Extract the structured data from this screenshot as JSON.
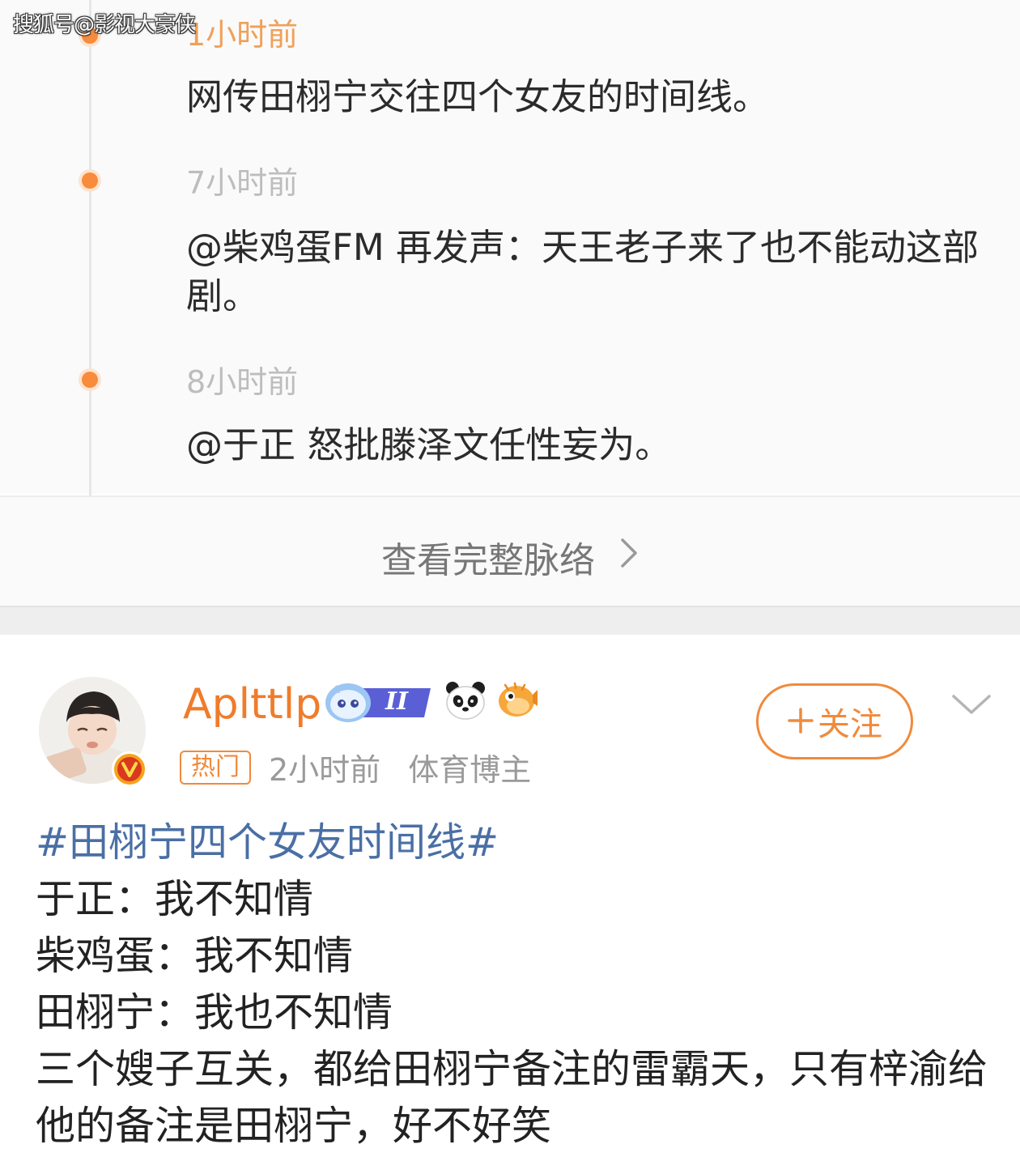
{
  "watermark": "搜狐号@影视大豪侠",
  "timeline": {
    "items": [
      {
        "time": "1小时前",
        "text": "网传田栩宁交往四个女友的时间线。"
      },
      {
        "time": "7小时前",
        "text": "@柴鸡蛋FM 再发声：天王老子来了也不能动这部剧。"
      },
      {
        "time": "8小时前",
        "text": "@于正 怒批滕泽文任性妄为。"
      }
    ],
    "view_full_label": "查看完整脉络"
  },
  "post": {
    "username": "Aplttlp",
    "level_badge": "II",
    "hot_tag": "热门",
    "time": "2小时前",
    "role": "体育博主",
    "follow_label": "关注",
    "hashtag": "#田栩宁四个女友时间线#",
    "lines": [
      "于正：我不知情",
      "柴鸡蛋：我不知情",
      "田栩宁：我也不知情",
      "三个嫂子互关，都给田栩宁备注的雷霸天，只有梓渝给他的备注是田栩宁，好不好笑"
    ]
  },
  "colors": {
    "accent_orange": "#f08a3c",
    "timeline_dot": "#f98b3c",
    "hashtag_blue": "#4a6fa5"
  },
  "icons": [
    "chevron-right-icon",
    "chevron-down-icon",
    "verified-v-icon",
    "panda-icon",
    "pufferfish-icon",
    "level-badge-icon",
    "plus-icon"
  ]
}
